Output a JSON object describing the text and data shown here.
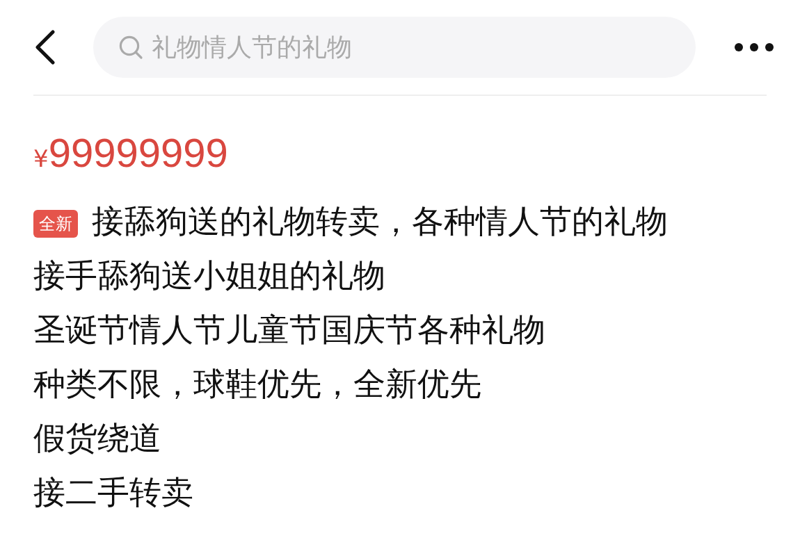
{
  "search": {
    "placeholder": "礼物情人节的礼物"
  },
  "price": {
    "currency": "¥",
    "amount": "99999999"
  },
  "badge": "全新",
  "description": [
    "接舔狗送的礼物转卖，各种情人节的礼物",
    "接手舔狗送小姐姐的礼物",
    "圣诞节情人节儿童节国庆节各种礼物",
    "种类不限，球鞋优先，全新优先",
    "假货绕道",
    "接二手转卖"
  ]
}
